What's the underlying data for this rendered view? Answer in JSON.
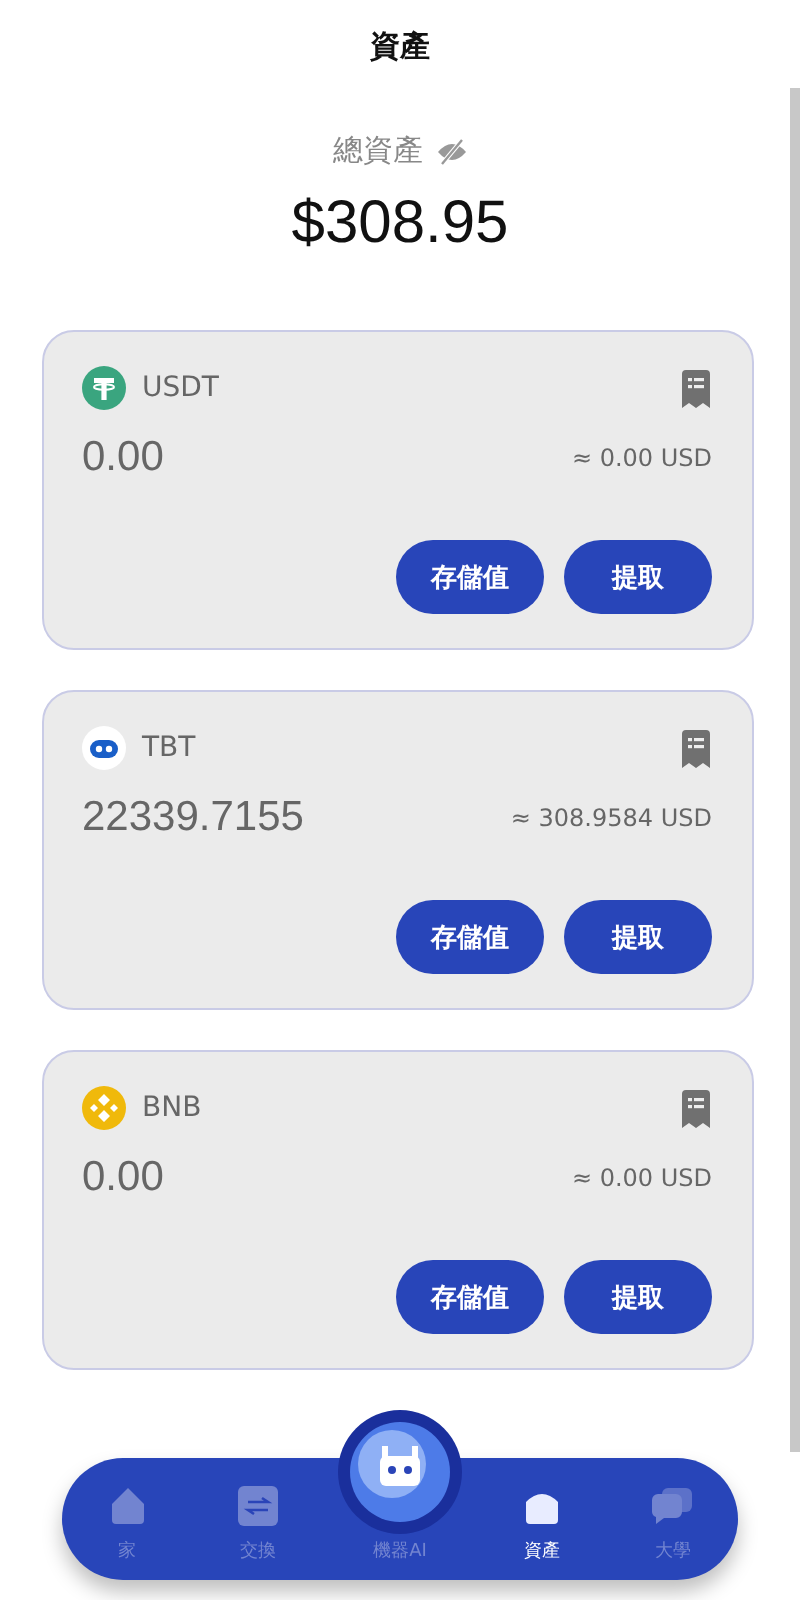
{
  "header": {
    "title": "資產"
  },
  "summary": {
    "label": "總資產",
    "hidden": true,
    "total": "$308.95"
  },
  "assets": [
    {
      "kind": "tether",
      "symbol": "USDT",
      "balance": "0.00",
      "usd": "≈ 0.00 USD",
      "actions": [
        "存儲值",
        "提取"
      ]
    },
    {
      "kind": "robot",
      "symbol": "TBT",
      "balance": "22339.7155",
      "usd": "≈ 308.9584 USD",
      "actions": [
        "存儲值",
        "提取"
      ]
    },
    {
      "kind": "bnb",
      "symbol": "BNB",
      "balance": "0.00",
      "usd": "≈ 0.00 USD",
      "actions": [
        "存儲值",
        "提取"
      ]
    }
  ],
  "nav": [
    {
      "kind": "home",
      "label": "家",
      "selected": false
    },
    {
      "kind": "swap",
      "label": "交換",
      "selected": false
    },
    {
      "kind": "ai",
      "label": "機器AI",
      "selected": false
    },
    {
      "kind": "wallet",
      "label": "資產",
      "selected": true
    },
    {
      "kind": "chat",
      "label": "大學",
      "selected": false
    }
  ]
}
